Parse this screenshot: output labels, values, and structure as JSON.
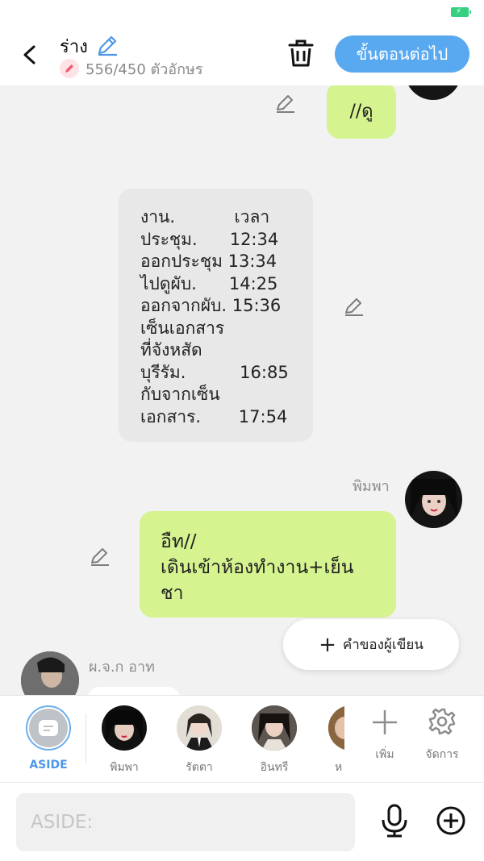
{
  "status": {
    "battery_color": "#35d07f"
  },
  "header": {
    "title": "ร่าง",
    "char_count": "556/450 ตัวอักษร",
    "next_button": "ขั้นตอนต่อไป",
    "accent": "#58a9f0"
  },
  "messages": [
    {
      "type": "green",
      "side": "right",
      "text": "//ดู"
    },
    {
      "type": "grey",
      "side": "center",
      "text": "งาน.           เวลา\nประชุม.      12:34\nออกประชุม 13:34\nไปดูผับ.      14:25\nออกจากผับ. 15:36\nเซ็นเอกสาร\nที่จังหสัด\nบุรีรัม.          16:85\nกับจากเซ็น\nเอกสาร.       17:54"
    },
    {
      "type": "green",
      "side": "right",
      "sender": "พิมพา",
      "text": "อืท//\nเดินเข้าห้องทำงาน+เย็น\nชา"
    },
    {
      "type": "partial",
      "side": "left",
      "sender": "ผ.จ.ก อาท"
    }
  ],
  "fab": {
    "label": "คำของผู้เขียน"
  },
  "characters": [
    {
      "label": "ASIDE"
    },
    {
      "label": "พิมพา"
    },
    {
      "label": "รัตตา"
    },
    {
      "label": "อินทรี"
    },
    {
      "label": "ห"
    }
  ],
  "tools": {
    "add": "เพิ่ม",
    "manage": "จัดการ"
  },
  "input": {
    "placeholder": "ASIDE:"
  }
}
